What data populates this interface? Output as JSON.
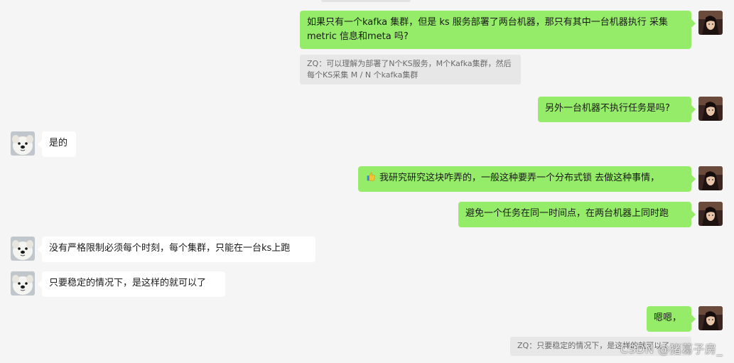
{
  "messages": [
    {
      "text": "如果只有一个kafka 集群，但是 ks 服务部署了两台机器，那只有其中一台机器执行 采集 metric 信息和meta 吗?"
    },
    {
      "text": "另外一台机器不执行任务是吗?"
    },
    {
      "text": "是的"
    },
    {
      "text": "我研究研究这块咋弄的，一般这种要弄一个分布式锁 去做这种事情，"
    },
    {
      "text": "避免一个任务在同一时间点，在两台机器上同时跑"
    },
    {
      "text": "没有严格限制必须每个时刻，每个集群，只能在一台ks上跑"
    },
    {
      "text": "只要稳定的情况下，是这样的就可以了"
    },
    {
      "text": "嗯嗯，"
    }
  ],
  "quotes": [
    {
      "text": "ZQ：可以理解为部署了N个KS服务，M个Kafka集群，然后每个KS采集 M / N 个kafka集群"
    },
    {
      "text": "ZQ：只要稳定的情况下，是这样的就可以了"
    }
  ],
  "icons": {
    "self_avatar": "user-avatar-icon",
    "other_avatar": "dog-avatar-icon",
    "emoji": "thumbs-up-icon"
  },
  "colors": {
    "self_bubble": "#95ec69",
    "other_bubble": "#ffffff",
    "background": "#f5f5f5",
    "quote_background": "#e7e7e7"
  },
  "watermark": "CSDN @猪葛子房_"
}
